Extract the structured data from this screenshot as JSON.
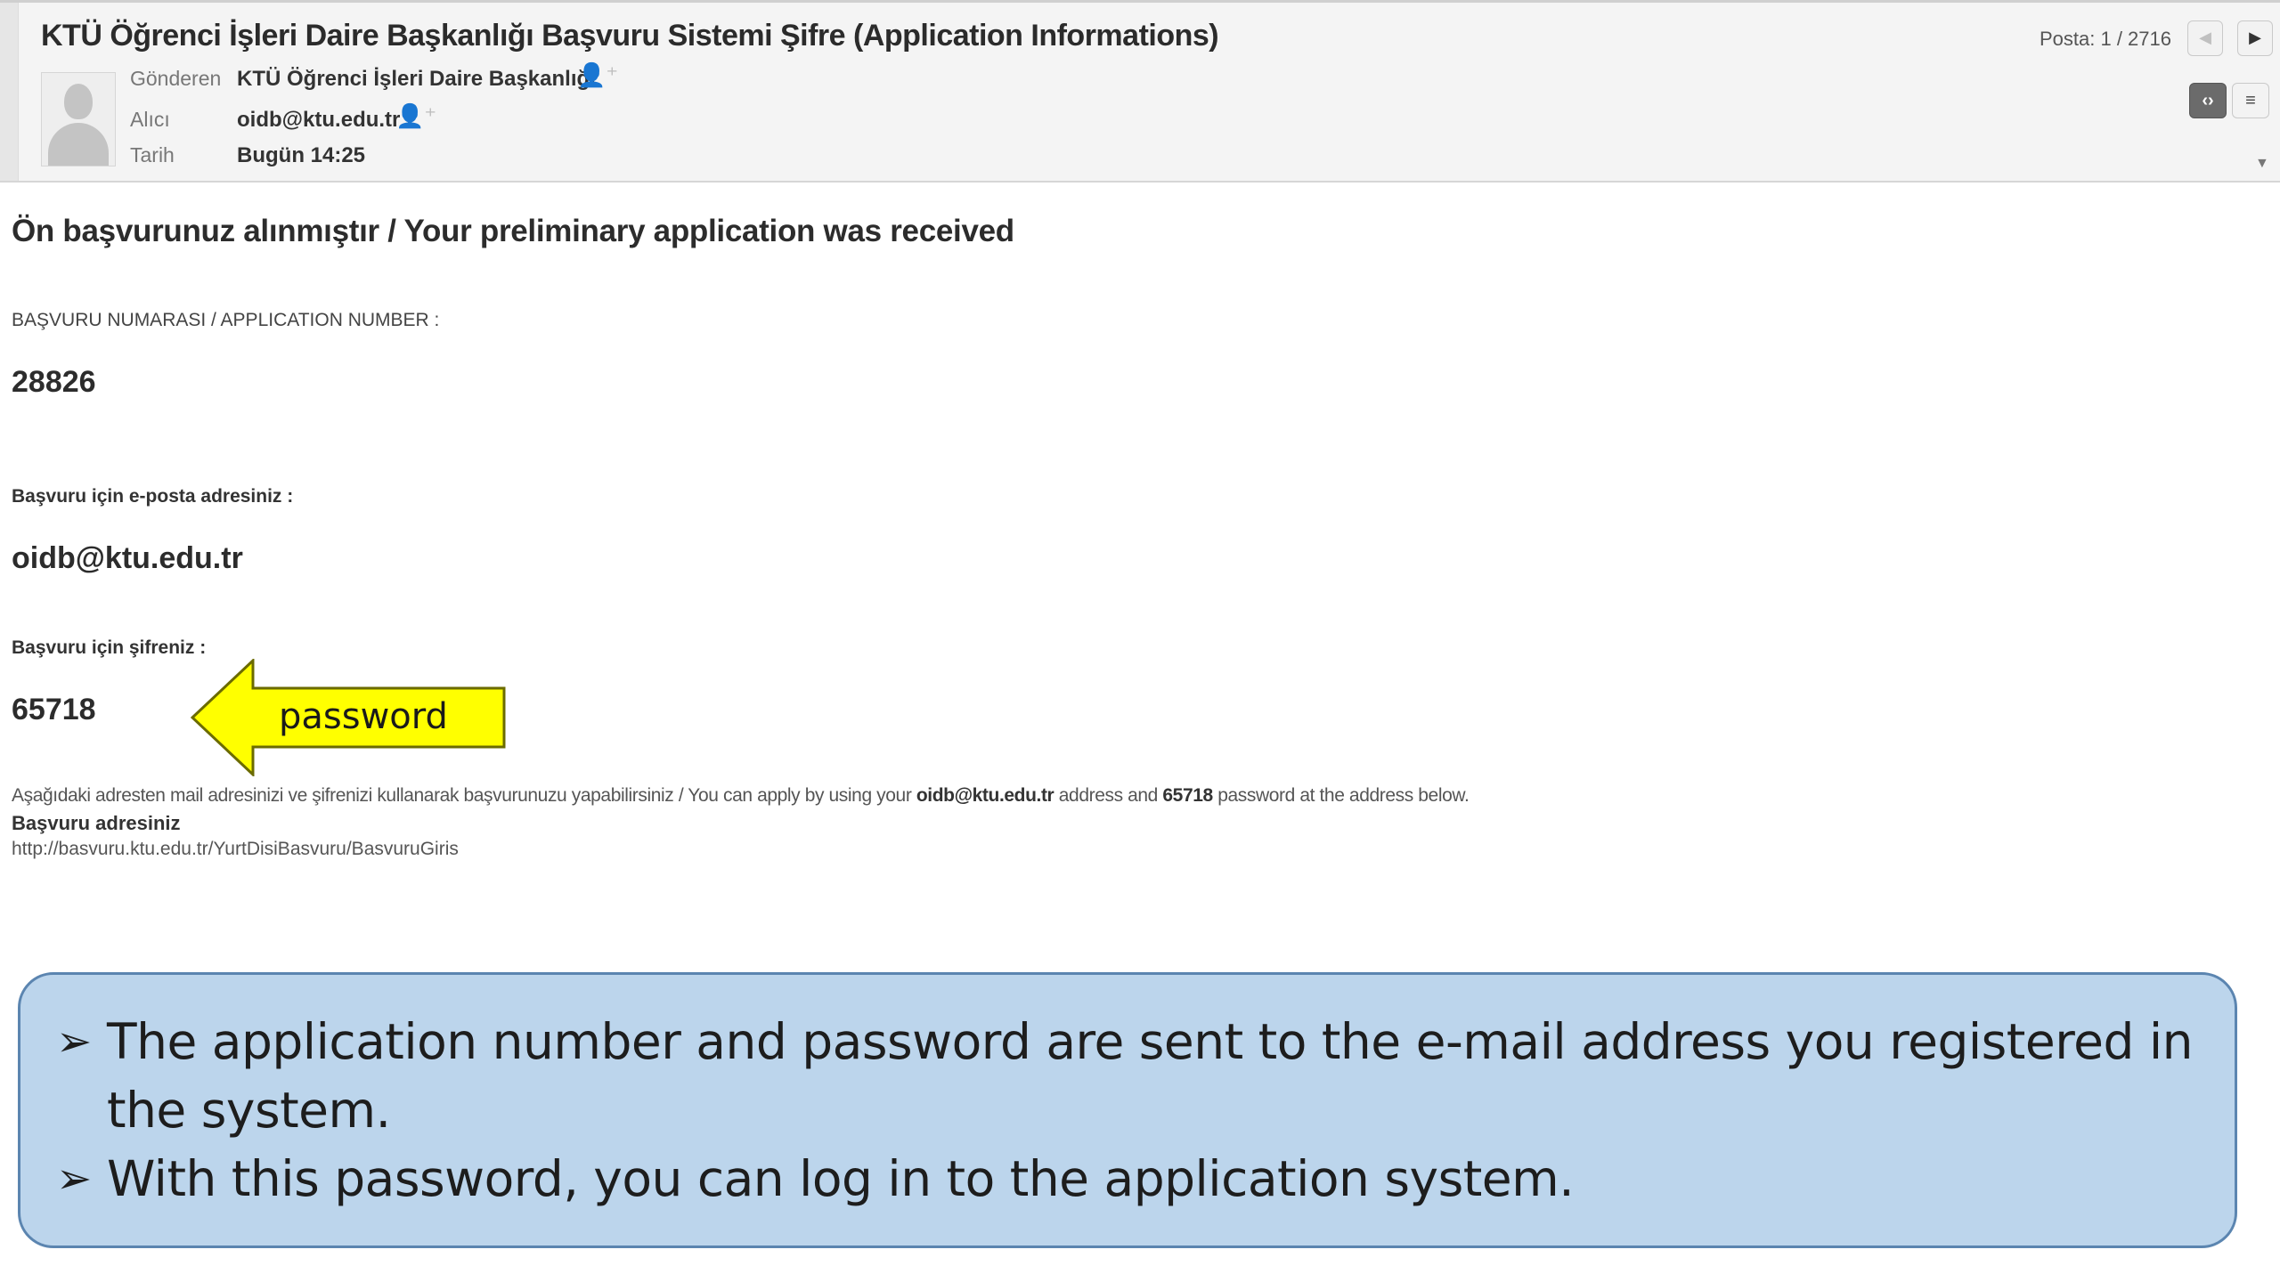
{
  "email": {
    "subject": "KTÜ Öğrenci İşleri Daire Başkanlığı Başvuru Sistemi Şifre (Application Informations)",
    "from_label": "Gönderen",
    "from_value": "KTÜ Öğrenci İşleri Daire Başkanlığı",
    "to_label": "Alıcı",
    "to_value": "oidb@ktu.edu.tr",
    "date_label": "Tarih",
    "date_value": "Bugün 14:25",
    "position_text": "Posta: 1 / 2716",
    "icons": {
      "add_contact": "add-contact-icon",
      "prev": "chevron-left-icon",
      "next": "chevron-right-icon",
      "html_view": "code-view-icon",
      "plain_view": "list-view-icon"
    }
  },
  "body": {
    "heading": "Ön başvurunuz alınmıştır / Your preliminary application was received",
    "application_number_label": "BAŞVURU NUMARASI / APPLICATION NUMBER :",
    "application_number": "28826",
    "email_label": "Başvuru için e-posta adresiniz :",
    "email_value": "oidb@ktu.edu.tr",
    "password_label": "Başvuru için şifreniz :",
    "password_value": "65718",
    "note_part1": "Aşağıdaki adresten mail adresinizi ve şifrenizi kullanarak başvurunuzu yapabilirsiniz / You can apply by using your ",
    "note_email": "oidb@ktu.edu.tr",
    "note_part2": " address and ",
    "note_password": "65718",
    "note_part3": " password at the address below.",
    "address_title": "Başvuru adresiniz",
    "address_url": "http://basvuru.ktu.edu.tr/YurtDisiBasvuru/BasvuruGiris"
  },
  "callout": {
    "text": "password",
    "fill_color": "#ffff00"
  },
  "info_box": {
    "items": [
      "The application number and password are sent to the e-mail address you registered in the system.",
      "With this password, you can log in to the application system."
    ],
    "bullet": "➢",
    "fill_color": "#bcd5ec",
    "border_color": "#5b85b0"
  }
}
